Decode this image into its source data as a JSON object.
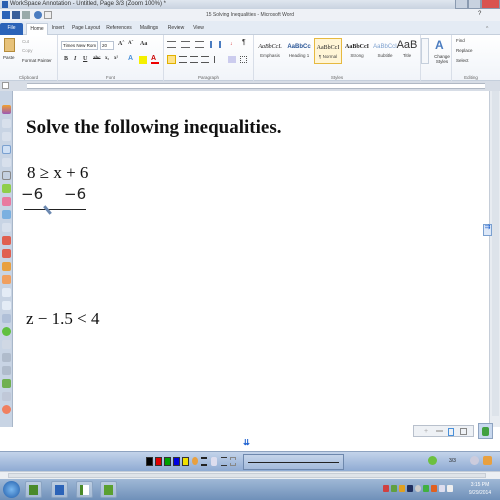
{
  "window": {
    "title": "WorkSpace Annotation - Untitled, Page 3/3  (Zoom 100%) *",
    "doc_title": "15 Solving Inequalities - Microsoft Word"
  },
  "ribbon_tabs": [
    {
      "label": "File"
    },
    {
      "label": "Home"
    },
    {
      "label": "Insert"
    },
    {
      "label": "Page Layout"
    },
    {
      "label": "References"
    },
    {
      "label": "Mailings"
    },
    {
      "label": "Review"
    },
    {
      "label": "View"
    }
  ],
  "clipboard": {
    "paste": "Paste",
    "cut": "Cut",
    "copy": "Copy",
    "format_painter": "Format Painter",
    "label": "Clipboard"
  },
  "font": {
    "name": "Times New Rom",
    "size": "20",
    "label": "Font",
    "bold": "B",
    "italic": "I",
    "underline": "U",
    "strike": "abc",
    "sub": "x₂",
    "sup": "x²",
    "grow": "Aˆ",
    "shrink": "Aˇ",
    "change_case": "Aa"
  },
  "paragraph": {
    "label": "Paragraph",
    "pilcrow": "¶"
  },
  "styles": {
    "label": "Styles",
    "items": [
      {
        "preview": "AaBbCcL",
        "name": "Emphasis"
      },
      {
        "preview": "AaBbCc",
        "name": "Heading 1"
      },
      {
        "preview": "AaBbCcI",
        "name": "¶ Normal"
      },
      {
        "preview": "AaBbCcI",
        "name": "Strong"
      },
      {
        "preview": "AaBbCcI",
        "name": "Subtitle"
      },
      {
        "preview": "AaB",
        "name": "Title"
      }
    ],
    "change_styles": "Change Styles"
  },
  "editing": {
    "label": "Editing",
    "find": "Find",
    "replace": "Replace",
    "select": "Select"
  },
  "document": {
    "heading": "Solve the following inequalities.",
    "problem1": "8 ≥ x + 6",
    "handwriting_left": "−6",
    "handwriting_right": "−6",
    "problem2": "z − 1.5 < 4"
  },
  "annotation_bar": {
    "colors": [
      "#000000",
      "#e00000",
      "#00a000",
      "#0000e0",
      "#f0e000"
    ],
    "page_indicator": "3/3"
  },
  "taskbar": {
    "time": "3:15 PM",
    "date": "9/29/2014"
  }
}
